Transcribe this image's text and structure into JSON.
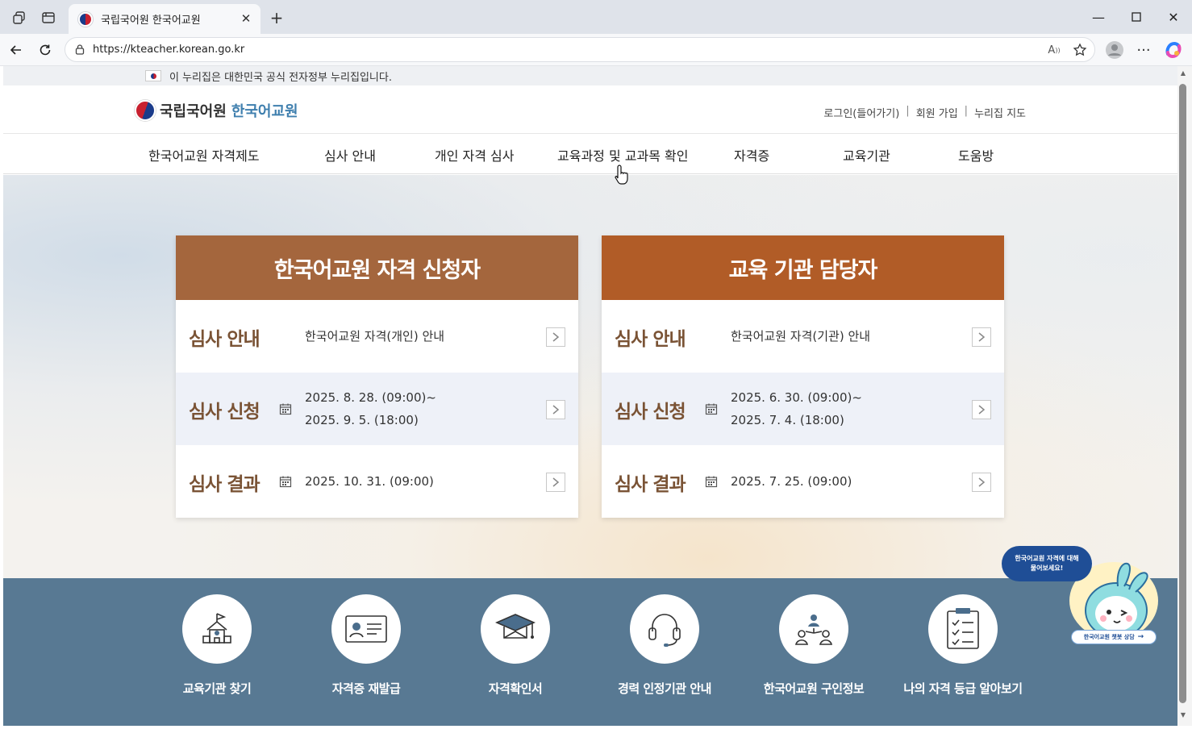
{
  "browser": {
    "tab_title": "국립국어원 한국어교원",
    "url": "https://kteacher.korean.go.kr"
  },
  "page": {
    "gov_banner": "이 누리집은 대한민국 공식 전자정부 누리집입니다.",
    "logo": {
      "org": "국립국어원",
      "site": "한국어교원"
    },
    "utility": {
      "login": "로그인(들어가기)",
      "signup": "회원 가입",
      "sitemap": "누리집 지도"
    },
    "nav": [
      "한국어교원 자격제도",
      "심사 안내",
      "개인 자격 심사",
      "교육과정 및 교과목 확인",
      "자격증",
      "교육기관",
      "도움방"
    ],
    "cards": [
      {
        "title": "한국어교원 자격 신청자",
        "color": "#a4663d",
        "rows": [
          {
            "label": "심사 안내",
            "lines": [
              "한국어교원 자격(개인) 안내"
            ],
            "calendar": false
          },
          {
            "label": "심사 신청",
            "lines": [
              "2025. 8. 28. (09:00)~",
              "2025. 9. 5. (18:00)"
            ],
            "calendar": true
          },
          {
            "label": "심사 결과",
            "lines": [
              "2025. 10. 31. (09:00)"
            ],
            "calendar": true
          }
        ]
      },
      {
        "title": "교육 기관 담당자",
        "color": "#b15c27",
        "rows": [
          {
            "label": "심사 안내",
            "lines": [
              "한국어교원 자격(기관) 안내"
            ],
            "calendar": false
          },
          {
            "label": "심사 신청",
            "lines": [
              "2025. 6. 30. (09:00)~",
              "2025. 7. 4. (18:00)"
            ],
            "calendar": true
          },
          {
            "label": "심사 결과",
            "lines": [
              "2025. 7. 25. (09:00)"
            ],
            "calendar": true
          }
        ]
      }
    ],
    "quick_links": [
      {
        "label": "교육기관 찾기",
        "icon": "school-icon"
      },
      {
        "label": "자격증 재발급",
        "icon": "id-card-icon"
      },
      {
        "label": "자격확인서",
        "icon": "graduation-cap-icon"
      },
      {
        "label": "경력 인정기관 안내",
        "icon": "headset-icon"
      },
      {
        "label": "한국어교원 구인정보",
        "icon": "people-network-icon"
      },
      {
        "label": "나의 자격 등급 알아보기",
        "icon": "clipboard-checklist-icon"
      }
    ],
    "chatbot": {
      "bubble_line1": "한국어교원 자격에 대해",
      "bubble_line2": "물어보세요!",
      "button": "한국어교원 챗봇 상담"
    },
    "band_color": "#587993"
  }
}
